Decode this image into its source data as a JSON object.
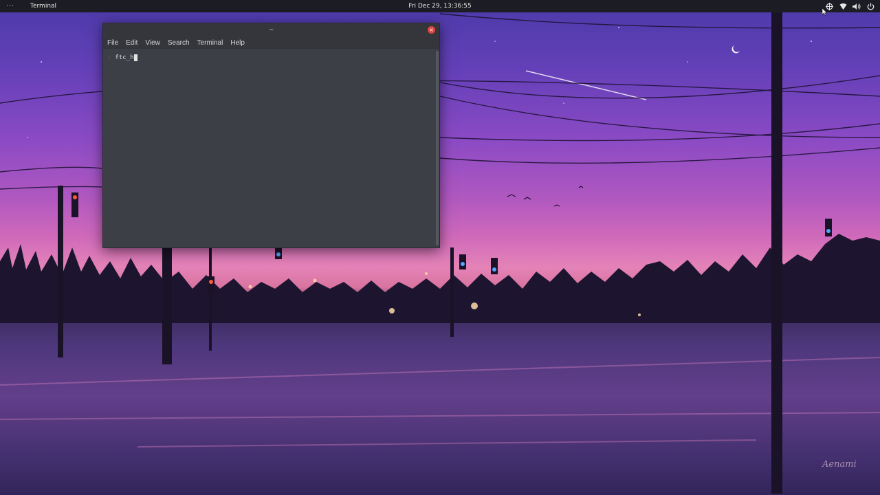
{
  "topbar": {
    "activities_label": "···",
    "app_name": "Terminal",
    "clock": "Fri Dec 29, 13:36:55",
    "tray_icons": [
      "network-icon",
      "wifi-icon",
      "volume-icon",
      "power-icon"
    ]
  },
  "terminal": {
    "title": "~",
    "menu": [
      "File",
      "Edit",
      "View",
      "Search",
      "Terminal",
      "Help"
    ],
    "prompt_symbol": "›",
    "input_text": "ftc_h"
  },
  "wallpaper": {
    "signature": "Aenami"
  },
  "colors": {
    "topbar_bg": "#1c1c24",
    "terminal_bg": "#3c3f45",
    "close_button": "#e0443e"
  }
}
